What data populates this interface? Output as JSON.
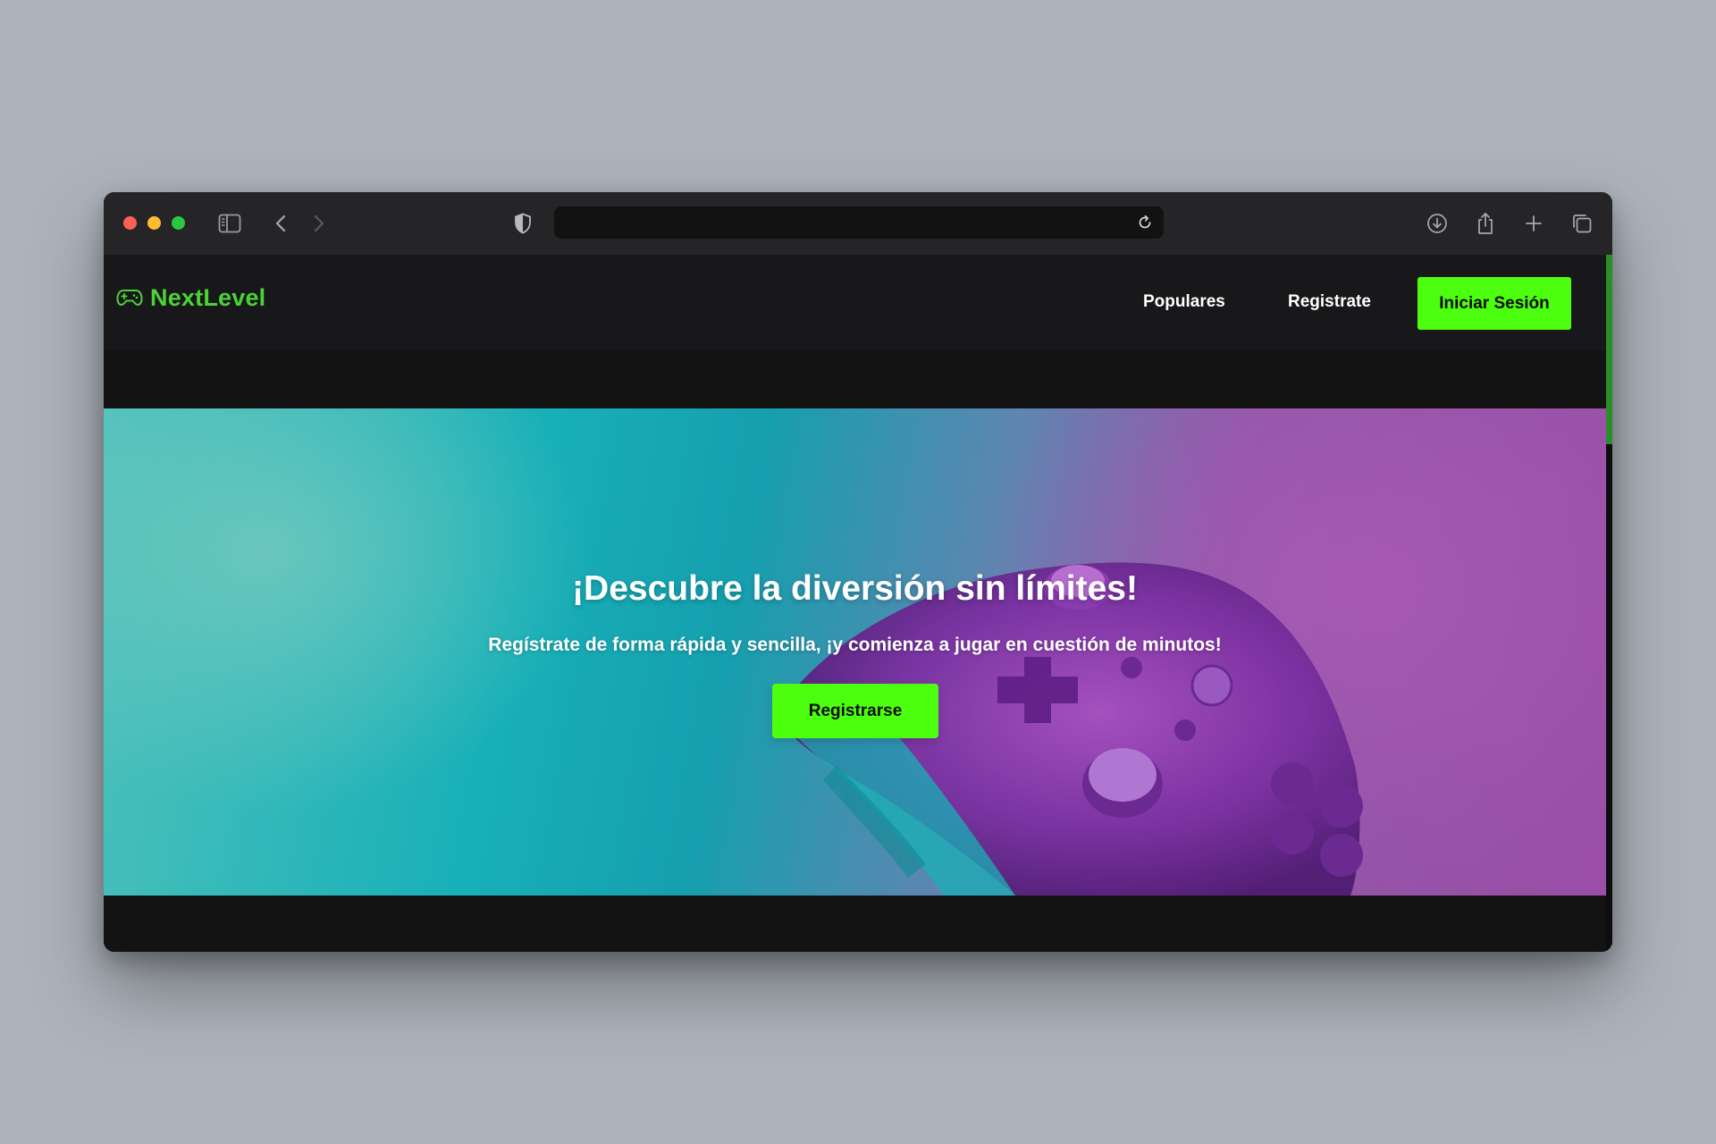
{
  "browser": {
    "url": "",
    "colors": {
      "close": "#ff5f57",
      "minimize": "#febc2e",
      "zoom": "#28c840"
    },
    "icons": [
      "sidebar-icon",
      "back-icon",
      "forward-icon",
      "shield-icon",
      "reload-icon",
      "download-icon",
      "share-icon",
      "new-tab-icon",
      "tabs-overview-icon"
    ]
  },
  "navbar": {
    "brand": "NextLevel",
    "brand_icon": "gamepad-icon",
    "links": [
      "Populares",
      "Registrate"
    ],
    "cta": "Iniciar Sesión"
  },
  "hero": {
    "title": "¡Descubre la diversión sin límites!",
    "subtitle": "Regístrate de forma rápida y sencilla, ¡y comienza a jugar en cuestión de minutos!",
    "button": "Registrarse"
  },
  "theme": {
    "accent": "#4cff0f",
    "brand_color": "#4cd137",
    "nav_bg": "#18181b",
    "page_bg": "#131313"
  }
}
